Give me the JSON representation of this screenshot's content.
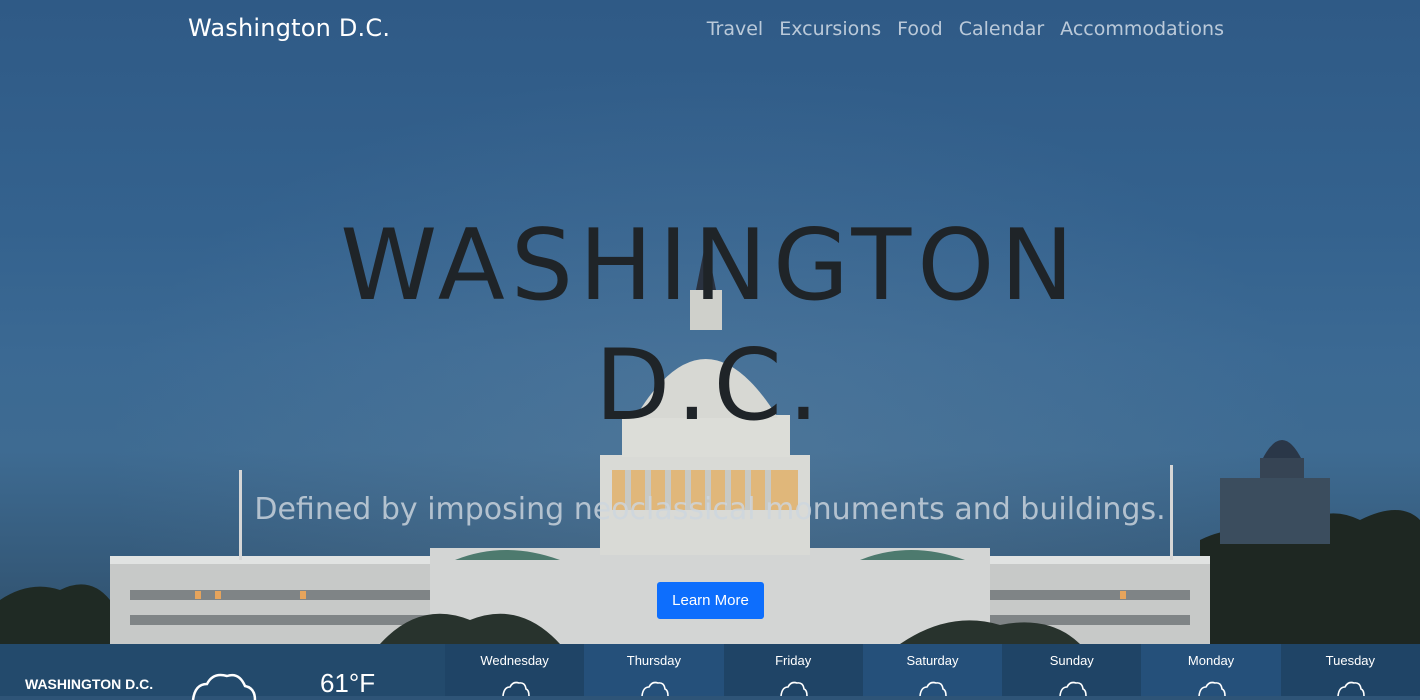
{
  "brand": "Washington D.C.",
  "nav": [
    "Travel",
    "Excursions",
    "Food",
    "Calendar",
    "Accommodations"
  ],
  "hero": {
    "title_line1": "WASHINGTON",
    "title_line2": "D.C.",
    "subtitle": "Defined by imposing neoclassical monuments and buildings.",
    "cta_label": "Learn More"
  },
  "weather": {
    "city": "WASHINGTON D.C.",
    "temp": "61°F",
    "current_icon": "cloud-icon",
    "days": [
      "Wednesday",
      "Thursday",
      "Friday",
      "Saturday",
      "Sunday",
      "Monday",
      "Tuesday"
    ]
  },
  "colors": {
    "cta": "#0d6efd",
    "weather_bar": "#234a6c"
  }
}
